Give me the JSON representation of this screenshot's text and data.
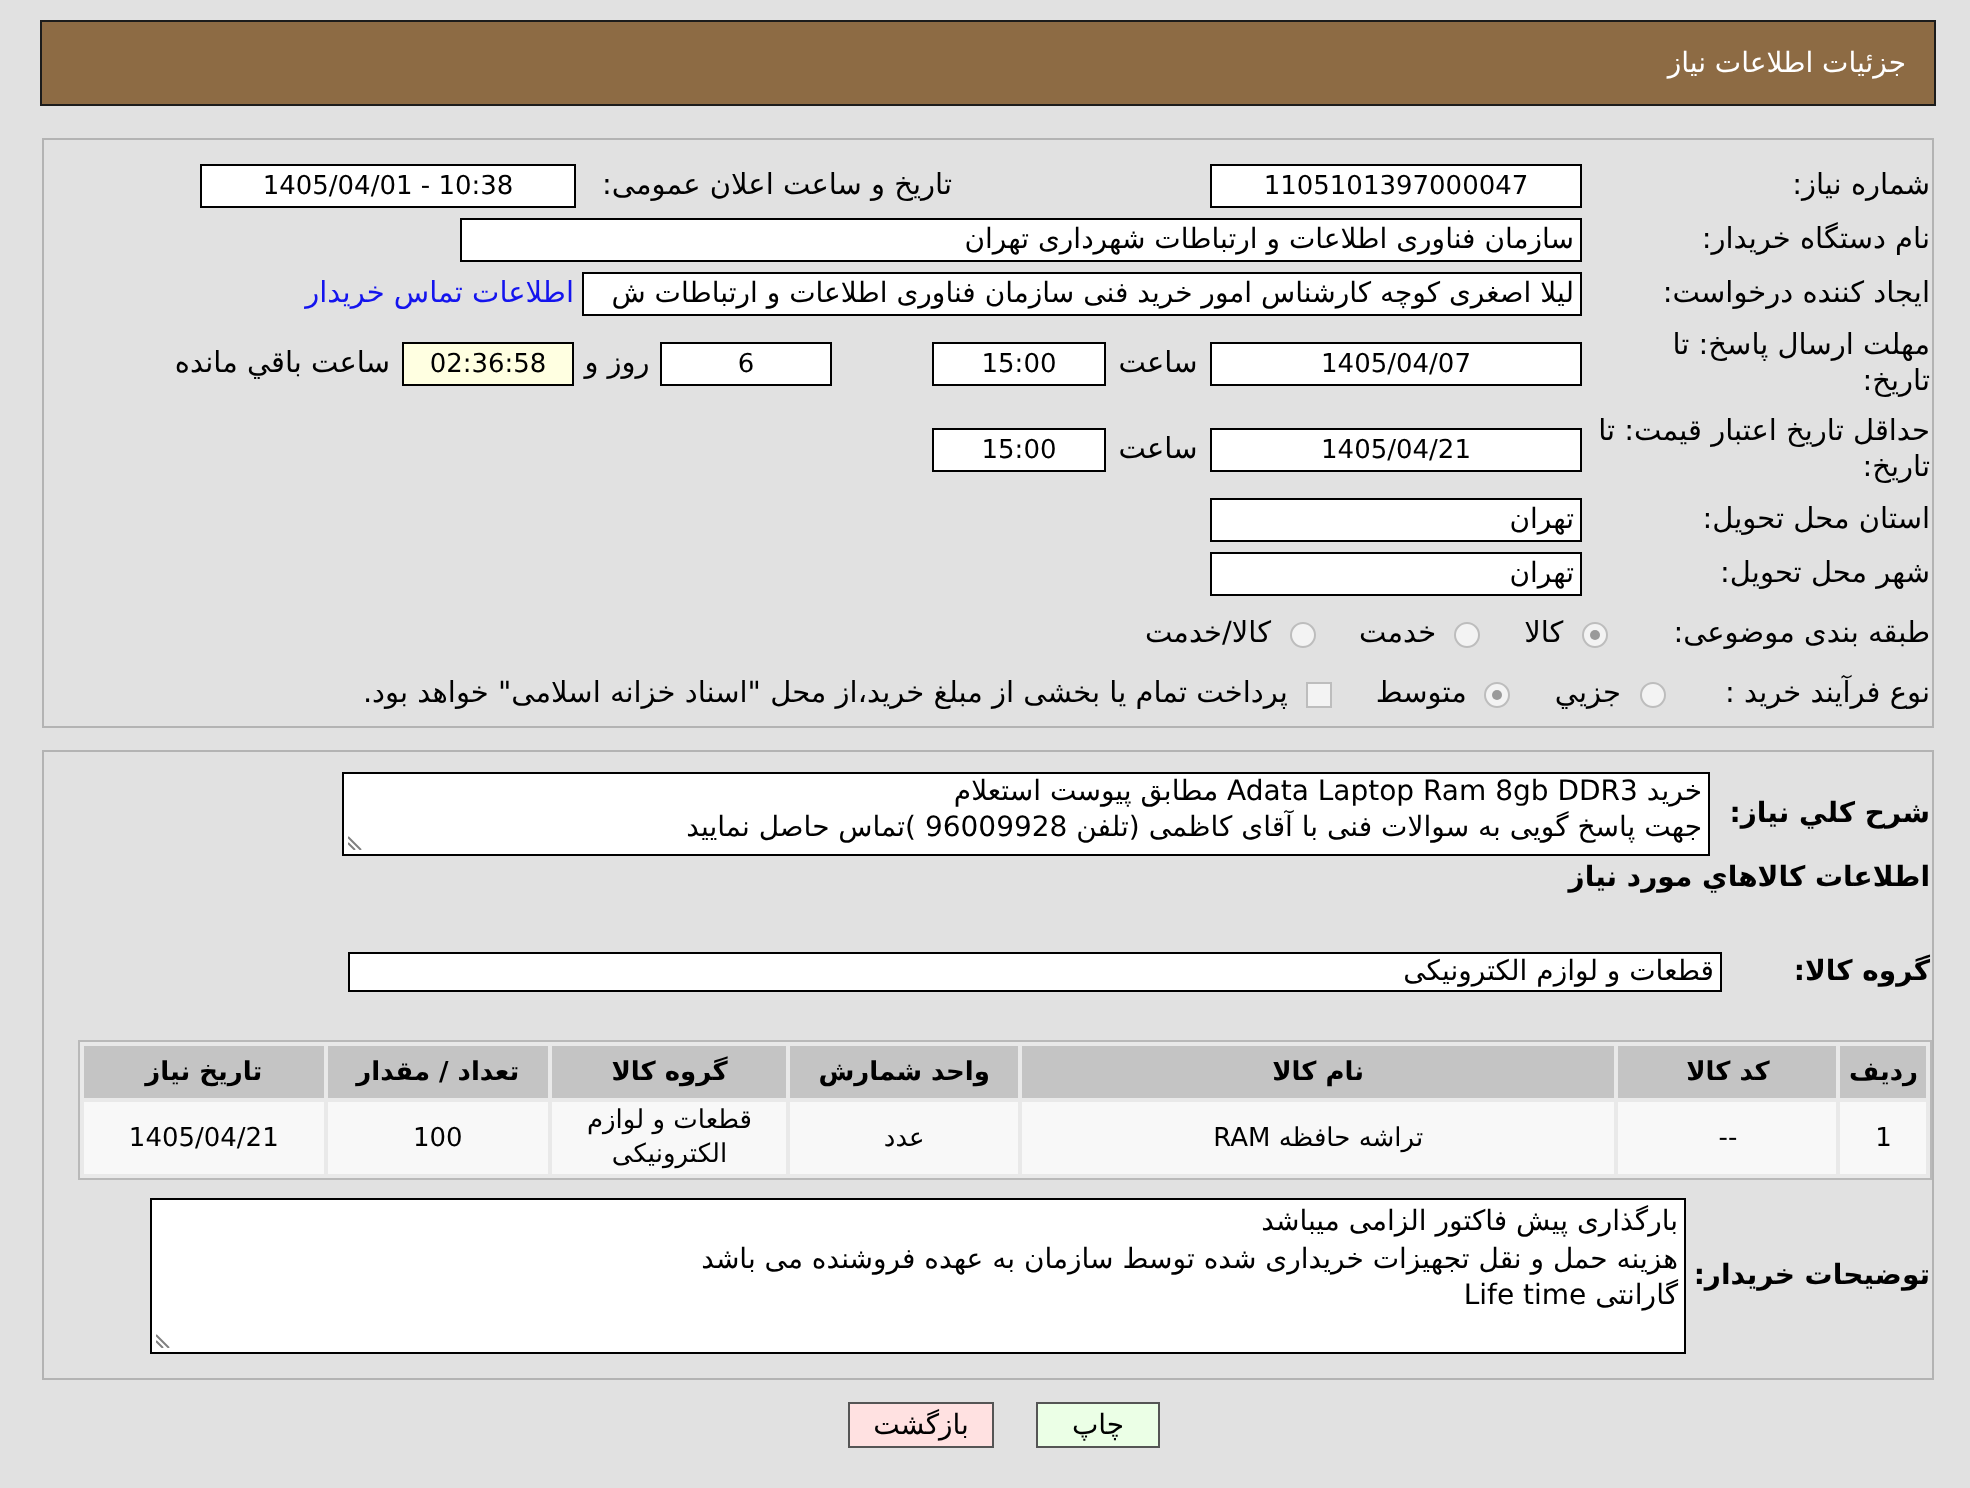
{
  "header": {
    "title": "جزئیات اطلاعات نیاز"
  },
  "details": {
    "need_number": {
      "label": "شماره نیاز:",
      "value": "1105101397000047"
    },
    "announcement": {
      "label": "تاریخ و ساعت اعلان عمومی:",
      "value": "1405/04/01 - 10:38"
    },
    "buyer_organization": {
      "label": "نام دستگاه خریدار:",
      "value": "سازمان فناوری اطلاعات و ارتباطات شهرداری تهران"
    },
    "requester": {
      "label": "ایجاد کننده درخواست:",
      "value": "لیلا اصغری کوچه کارشناس امور خرید فنی سازمان فناوری اطلاعات و ارتباطات ش",
      "link": "اطلاعات تماس خریدار"
    },
    "reply_deadline": {
      "label": "مهلت ارسال پاسخ: تا تاریخ:",
      "date": "1405/04/07",
      "time_label": "ساعت",
      "time": "15:00",
      "days": "6",
      "days_label": "روز و",
      "remaining": "02:36:58",
      "remaining_label": "ساعت باقي مانده"
    },
    "price_validity": {
      "label": "حداقل تاریخ اعتبار قیمت: تا تاریخ:",
      "date": "1405/04/21",
      "time_label": "ساعت",
      "time": "15:00"
    },
    "delivery_province": {
      "label": "استان محل تحویل:",
      "value": "تهران"
    },
    "delivery_city": {
      "label": "شهر محل تحویل:",
      "value": "تهران"
    },
    "subject_category": {
      "label": "طبقه بندی موضوعی:",
      "options": [
        {
          "label": "کالا",
          "selected": true,
          "disabled": true
        },
        {
          "label": "خدمت",
          "selected": false,
          "disabled": true
        },
        {
          "label": "کالا/خدمت",
          "selected": false,
          "disabled": true
        }
      ]
    },
    "purchase_process": {
      "label": "نوع فرآیند خرید :",
      "options": [
        {
          "label": "جزیي",
          "selected": false,
          "disabled": true
        },
        {
          "label": "متوسط",
          "selected": true,
          "disabled": true
        }
      ],
      "treasury_payment": {
        "label": "پرداخت تمام یا بخشی از مبلغ خرید،از محل \"اسناد خزانه اسلامی\" خواهد بود.",
        "checked": false,
        "disabled": true
      }
    }
  },
  "needs": {
    "summary": {
      "label": "شرح کلي نیاز:",
      "lines": [
        "خرید Adata Laptop Ram 8gb DDR3 مطابق پیوست استعلام",
        "جهت پاسخ گویی به سوالات فنی با آقای کاظمی (تلفن 96009928 )تماس حاصل نمایید"
      ]
    },
    "goods_heading": "اطلاعات کالاهاي مورد نیاز",
    "goods_group": {
      "label": "گروه کالا:",
      "value": "قطعات و لوازم الکترونیکی"
    },
    "table": {
      "columns": [
        "ردیف",
        "کد کالا",
        "نام کالا",
        "واحد شمارش",
        "گروه کالا",
        "تعداد / مقدار",
        "تاریخ نیاز"
      ],
      "rows": [
        [
          "1",
          "--",
          "تراشه حافظه RAM",
          "عدد",
          "قطعات و لوازم الکترونیکی",
          "100",
          "1405/04/21"
        ]
      ]
    },
    "buyer_notes": {
      "label": "توضیحات خریدار:",
      "lines": [
        "بارگذاری پیش فاکتور الزامی میباشد",
        "هزینه حمل و نقل تجهیزات خریداری شده توسط سازمان به عهده فروشنده می باشد",
        "گارانتی Life time"
      ]
    }
  },
  "buttons": [
    {
      "label": "چاپ",
      "kind": "print"
    },
    {
      "label": "بازگشت",
      "kind": "back"
    }
  ]
}
